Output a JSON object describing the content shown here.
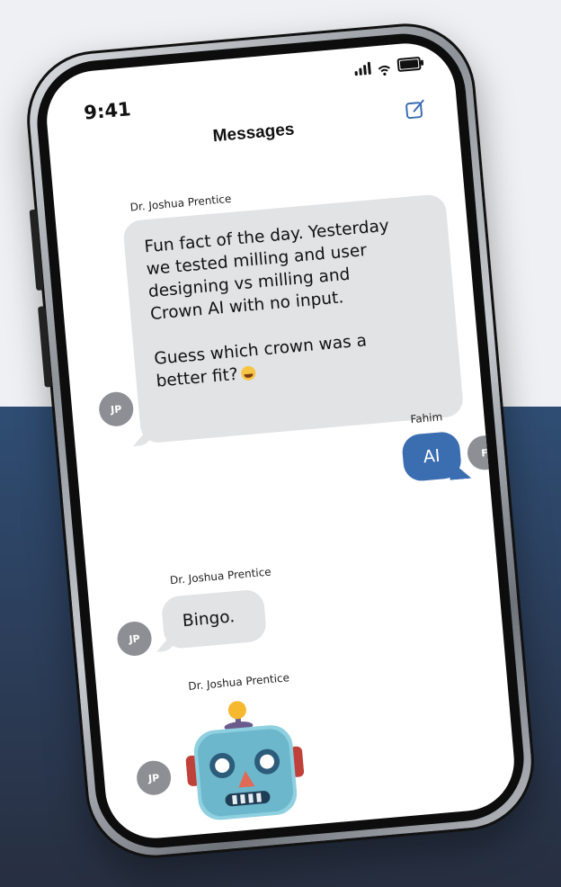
{
  "status": {
    "time": "9:41"
  },
  "header": {
    "title": "Messages",
    "compose_icon": "compose-icon"
  },
  "messages": [
    {
      "sender": "Dr. Joshua Prentice",
      "initials": "JP",
      "lines": [
        "Fun fact of the day. Yesterday",
        "we tested milling and user",
        "designing vs milling and",
        "Crown AI with no input.",
        "",
        "Guess which crown was a",
        "better fit?"
      ],
      "emoji": "grinning-squint-emoji"
    },
    {
      "sender": "Fahim",
      "initials": "F",
      "text": "AI"
    },
    {
      "sender": "Dr. Joshua Prentice",
      "initials": "JP",
      "text": "Bingo."
    },
    {
      "sender": "Dr. Joshua Prentice",
      "initials": "JP",
      "emoji": "robot-emoji"
    }
  ],
  "colors": {
    "background_top": "#eef0f3",
    "background_bottom": "#2f4d73",
    "incoming_bubble": "#e2e3e5",
    "outgoing_bubble": "#3b6db1",
    "avatar": "#8d8f94"
  }
}
